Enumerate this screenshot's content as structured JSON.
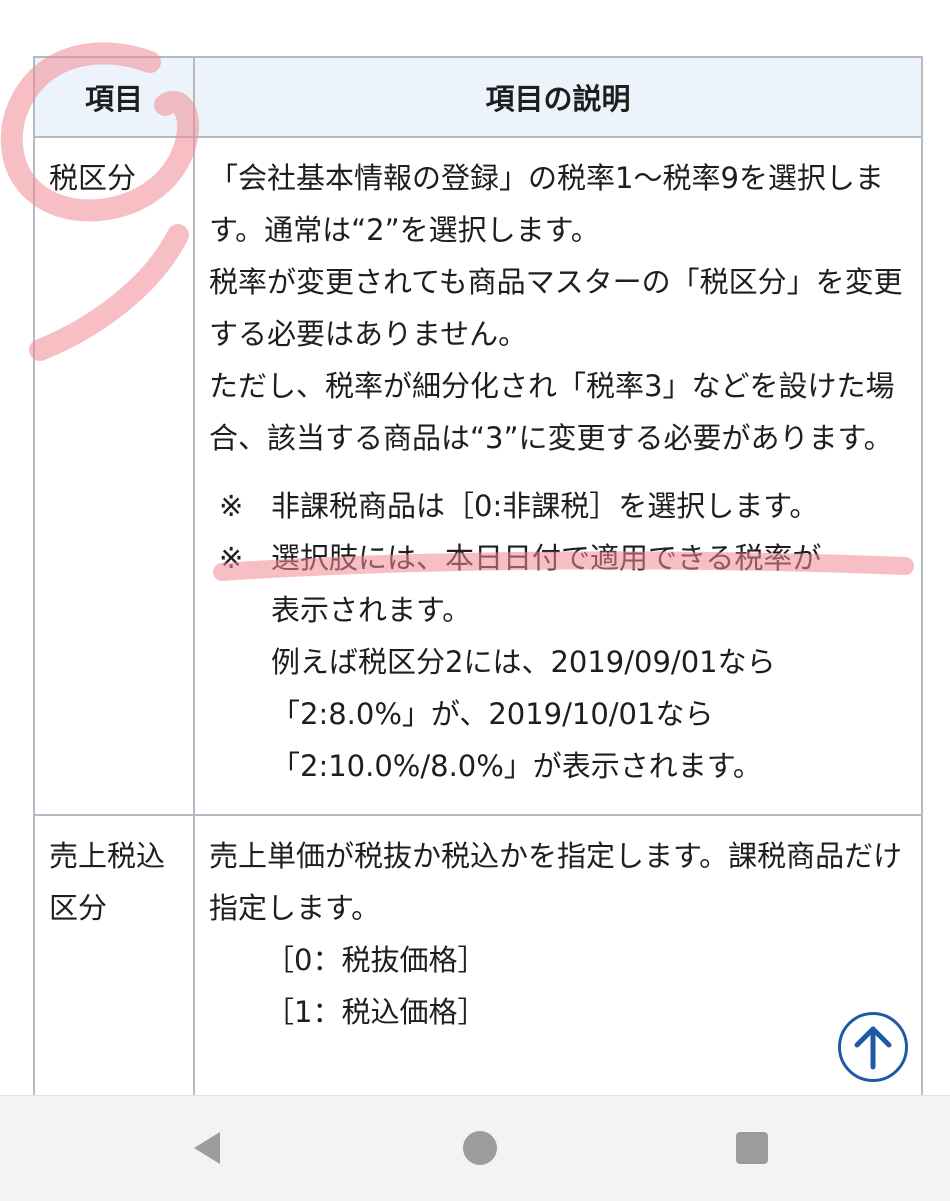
{
  "table": {
    "headers": [
      "項目",
      "項目の説明"
    ],
    "rows": [
      {
        "item": "税区分",
        "paragraphs": [
          "「会社基本情報の登録」の税率1〜税率9を選択します。通常は“2”を選択します。",
          "税率が変更されても商品マスターの「税区分」を変更する必要はありません。",
          "ただし、税率が細分化され「税率3」などを設けた場合、該当する商品は“3”に変更する必要があります。"
        ],
        "notes": [
          {
            "mark": "※",
            "text": "非課税商品は［0:非課税］を選択します。"
          },
          {
            "mark": "※",
            "text": "選択肢には、本日日付で適用できる税率が"
          }
        ],
        "note_continuation": [
          "表示されます。",
          "例えば税区分2には、2019/09/01なら",
          "「2:8.0%」が、2019/10/01なら",
          "「2:10.0%/8.0%」が表示されます。"
        ]
      },
      {
        "item": "売上税込区分",
        "paragraphs": [
          "売上単価が税抜か税込かを指定します。課税商品だけ指定します。"
        ],
        "options": [
          "［0：税抜価格］",
          "［1：税込価格］"
        ]
      }
    ]
  },
  "scroll_top": {
    "icon": "arrow-up-icon"
  },
  "nav": {
    "back_icon": "back-triangle-icon",
    "home_icon": "home-circle-icon",
    "recent_icon": "recent-square-icon"
  },
  "colors": {
    "header_bg": "#edf3fb",
    "border": "#b4b9c3",
    "accent_blue": "#1f5aa6",
    "annotation_pink": "#f08a94"
  }
}
